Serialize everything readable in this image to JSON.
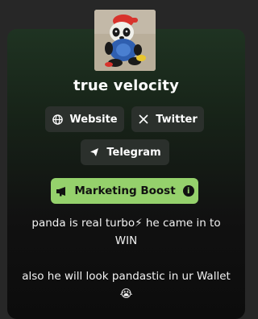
{
  "token": {
    "name": "true velocity",
    "avatar_icon": "panda-avatar"
  },
  "links": {
    "website_label": "Website",
    "twitter_label": "Twitter",
    "telegram_label": "Telegram"
  },
  "boost": {
    "label": "Marketing Boost",
    "info_glyph": "i"
  },
  "description": {
    "line1": "panda is real turbo⚡ he came in to",
    "line2": "WIN",
    "line3": "also he will look pandastic in ur Wallet",
    "line4": "😭"
  },
  "colors": {
    "accent": "#95d16c",
    "button_bg": "#2b302c",
    "page_bg": "#272727"
  }
}
